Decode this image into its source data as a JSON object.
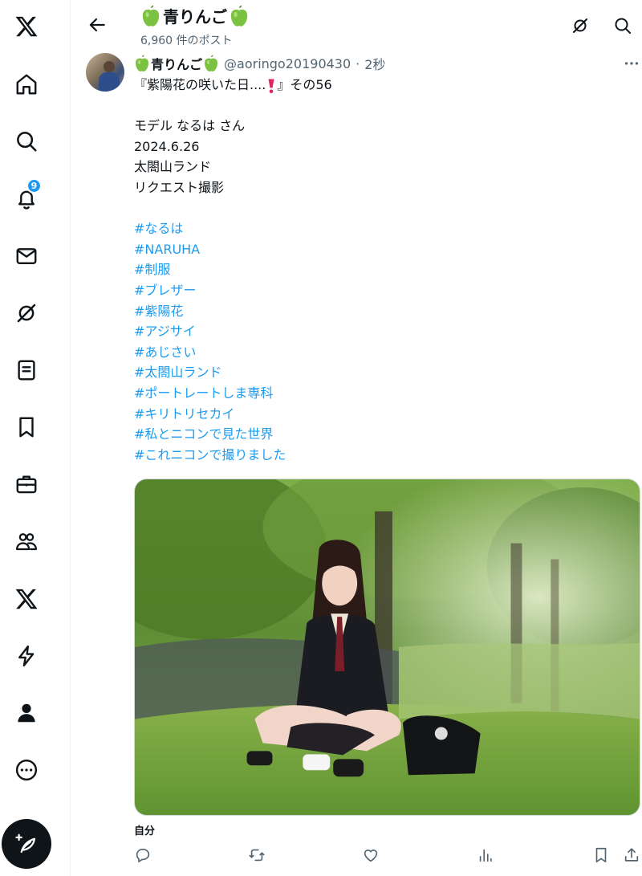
{
  "header": {
    "title": "青りんご",
    "post_count": "6,960 件のポスト"
  },
  "sidebar": {
    "notification_badge": "9",
    "items": [
      "x-logo",
      "home",
      "explore",
      "notifications",
      "messages",
      "grok",
      "lists",
      "bookmarks",
      "jobs",
      "communities",
      "premium",
      "verified-orgs",
      "profile",
      "more"
    ]
  },
  "post": {
    "display_name": "青りんご",
    "handle": "@aoringo20190430",
    "separator": "·",
    "time": "2秒",
    "lines": [
      "『紫陽花の咲いた日....",
      "』その56",
      "モデル なるは さん",
      "2024.6.26",
      "太閤山ランド",
      "リクエスト撮影"
    ],
    "hashtags": [
      "#なるは",
      "#NARUHA",
      "#制服",
      "#ブレザー",
      "#紫陽花",
      "#アジサイ",
      "#あじさい",
      "#太閤山ランド",
      "#ポートレートしま専科",
      "#キリトリセカイ",
      "#私とニコンで見た世界",
      "#これニコンで撮りました"
    ],
    "photo_caption": "自分"
  },
  "colors": {
    "accent": "#1d9bf0",
    "text": "#0f1419",
    "secondary": "#536471"
  }
}
